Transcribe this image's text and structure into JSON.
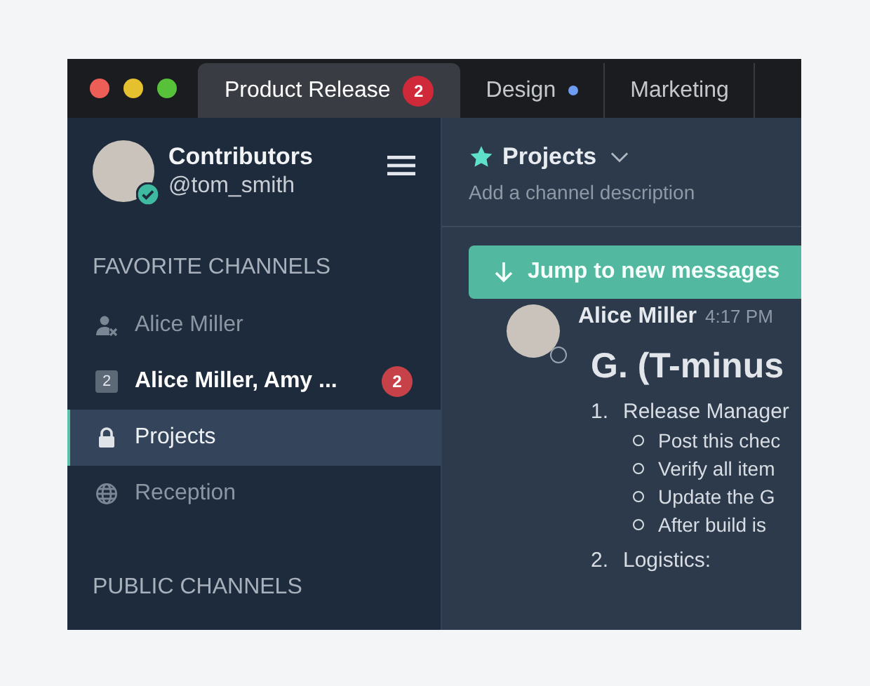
{
  "tabs": [
    {
      "label": "Product Release",
      "selected": true,
      "badge": "2",
      "unread_dot": false
    },
    {
      "label": "Design",
      "selected": false,
      "unread_dot": true
    },
    {
      "label": "Marketing",
      "selected": false,
      "unread_dot": false
    }
  ],
  "sidebar": {
    "team": "Contributors",
    "username": "@tom_smith",
    "online": true,
    "sections": [
      {
        "title": "FAVORITE CHANNELS",
        "items": [
          {
            "kind": "dm",
            "label": "Alice Miller",
            "selected": false,
            "unread": false
          },
          {
            "kind": "group",
            "count": "2",
            "label": "Alice Miller, Amy ...",
            "selected": false,
            "unread": true,
            "badge": "2"
          },
          {
            "kind": "private",
            "label": "Projects",
            "selected": true,
            "unread": false
          },
          {
            "kind": "public",
            "label": "Reception",
            "selected": false,
            "unread": false
          }
        ]
      },
      {
        "title": "PUBLIC CHANNELS"
      }
    ]
  },
  "channel": {
    "name": "Projects",
    "favorite": true,
    "description": "Add a channel description"
  },
  "jump_button": "Jump to new messages",
  "message": {
    "author": "Alice Miller",
    "time": "4:17 PM",
    "online": false,
    "heading": "G. (T-minus",
    "list": [
      {
        "number": "1.",
        "label": "Release Manager",
        "children": [
          "Post this chec",
          "Verify all item",
          "Update the G",
          "After build is"
        ]
      },
      {
        "number": "2.",
        "label": "Logistics:"
      }
    ]
  }
}
